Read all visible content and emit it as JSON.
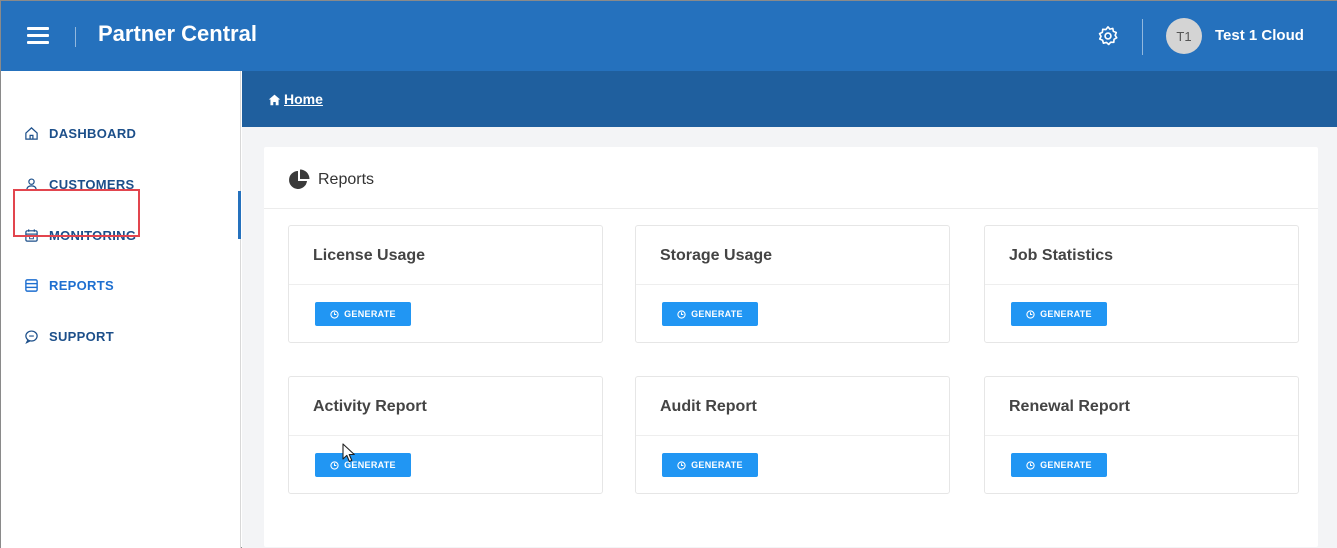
{
  "app": {
    "title": "Partner Central"
  },
  "user": {
    "initials": "T1",
    "name": "Test 1 Cloud"
  },
  "sidebar": {
    "items": [
      {
        "label": "DASHBOARD",
        "icon": "home-outline-icon"
      },
      {
        "label": "CUSTOMERS",
        "icon": "person-outline-icon"
      },
      {
        "label": "MONITORING",
        "icon": "calendar-icon"
      },
      {
        "label": "REPORTS",
        "icon": "report-icon",
        "active": true
      },
      {
        "label": "SUPPORT",
        "icon": "chat-bubble-icon"
      }
    ]
  },
  "breadcrumb": {
    "label": " Home",
    "icon": "home-icon"
  },
  "panel": {
    "title": "Reports",
    "icon": "pie-chart-icon"
  },
  "cards": [
    {
      "title": "License Usage",
      "button": "GENERATE"
    },
    {
      "title": "Storage Usage",
      "button": "GENERATE"
    },
    {
      "title": "Job Statistics",
      "button": "GENERATE"
    },
    {
      "title": "Activity Report",
      "button": "GENERATE"
    },
    {
      "title": "Audit Report",
      "button": "GENERATE"
    },
    {
      "title": "Renewal Report",
      "button": "GENERATE"
    }
  ],
  "colors": {
    "topbar": "#2571bd",
    "breadcrumb_bar": "#1f5f9e",
    "nav_text": "#1c4f8a",
    "button": "#2196f3",
    "highlight": "#e2454e"
  }
}
